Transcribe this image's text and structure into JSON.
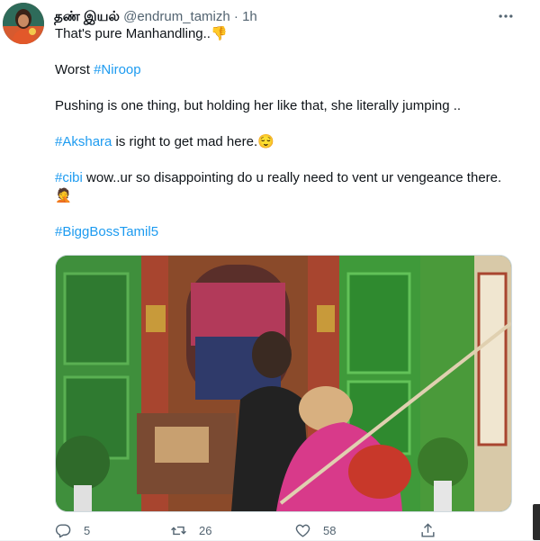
{
  "tweet": {
    "display_name": "தண் இயல்",
    "handle": "@endrum_tamizh",
    "separator": "·",
    "time": "1h",
    "line1": "That's pure Manhandling..",
    "line1_emoji": "👎",
    "line2_prefix": "Worst ",
    "line2_tag": "#Niroop",
    "line3": "Pushing is one thing, but holding her like that, she literally jumping ..",
    "line4_tag": "#Akshara",
    "line4_text": " is right to get mad here.",
    "line4_emoji": "😌",
    "line5_tag": "#cibi",
    "line5_text": " wow..ur so disappointing do u really need to vent ur vengeance there.",
    "line5_emoji": "🤦",
    "line6_tag": "#BiggBossTamil5"
  },
  "actions": {
    "reply_count": "5",
    "retweet_count": "26",
    "like_count": "58"
  },
  "colors": {
    "link": "#1d9bf0",
    "secondary_text": "#536471",
    "primary_text": "#0f1419"
  },
  "icons": [
    "more-icon",
    "reply-icon",
    "retweet-icon",
    "like-icon",
    "share-icon"
  ]
}
